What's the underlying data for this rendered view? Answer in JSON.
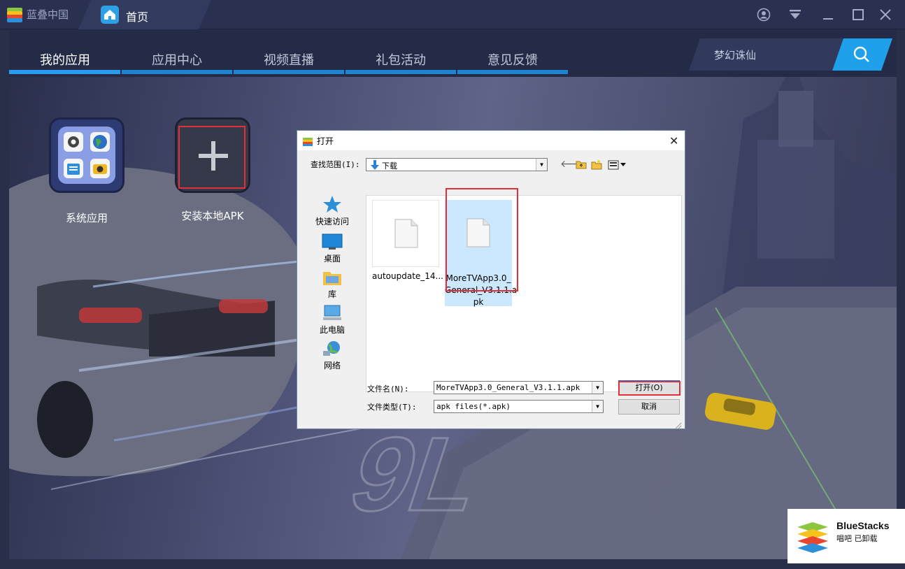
{
  "brand": {
    "name": "蓝叠中国"
  },
  "home_tab": {
    "label": "首页"
  },
  "window_controls": {
    "user": "user-icon",
    "menu": "dropdown-icon",
    "minimize": "minimize-icon",
    "maximize": "maximize-icon",
    "close": "close-icon"
  },
  "nav": {
    "tabs": [
      {
        "label": "我的应用",
        "active": true
      },
      {
        "label": "应用中心",
        "active": false
      },
      {
        "label": "视频直播",
        "active": false
      },
      {
        "label": "礼包活动",
        "active": false
      },
      {
        "label": "意见反馈",
        "active": false
      }
    ]
  },
  "search": {
    "value": "梦幻诛仙",
    "icon": "search-icon"
  },
  "desktop": {
    "tiles": [
      {
        "label": "系统应用",
        "icon": "system-apps-icon"
      },
      {
        "label": "安装本地APK",
        "icon": "plus-icon"
      }
    ]
  },
  "dialog": {
    "title": "打开",
    "lookin_label": "查找范围(I):",
    "lookin_value": "下载",
    "places": [
      "快速访问",
      "桌面",
      "库",
      "此电脑",
      "网络"
    ],
    "files": [
      {
        "name": "autoupdate_14...",
        "selected": false
      },
      {
        "name": "MoreTVApp3.0_General_V3.1.1.apk",
        "lines": [
          "MoreTVApp3.0_",
          "General_V3.1.1.a",
          "pk"
        ],
        "selected": true
      }
    ],
    "filename_label": "文件名(N):",
    "filename_value": "MoreTVApp3.0_General_V3.1.1.apk",
    "filetype_label": "文件类型(T):",
    "filetype_value": "apk files(*.apk)",
    "open_button": "打开(O)",
    "cancel_button": "取消"
  },
  "watermark": {
    "title": "BlueStacks",
    "subtitle": "唱吧 已卸载"
  },
  "colors": {
    "accent": "#1f84d4",
    "highlight": "#e2303a",
    "search": "#1ea0ea"
  }
}
